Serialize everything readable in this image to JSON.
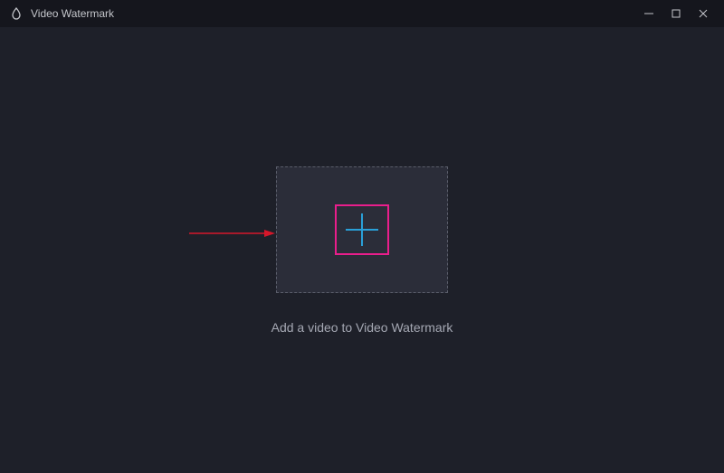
{
  "titlebar": {
    "app_name": "Video Watermark"
  },
  "main": {
    "helper_text": "Add a video to Video Watermark"
  },
  "colors": {
    "accent_blue": "#2aa0d8",
    "highlight_pink": "#e91e8c",
    "arrow_red": "#d6172a",
    "bg_dark": "#1e2029",
    "bg_titlebar": "#15161d",
    "dropzone_bg": "#2b2d39"
  },
  "icons": {
    "app": "water-drop-icon",
    "add": "plus-icon",
    "minimize": "minimize-icon",
    "maximize": "maximize-icon",
    "close": "close-icon"
  }
}
